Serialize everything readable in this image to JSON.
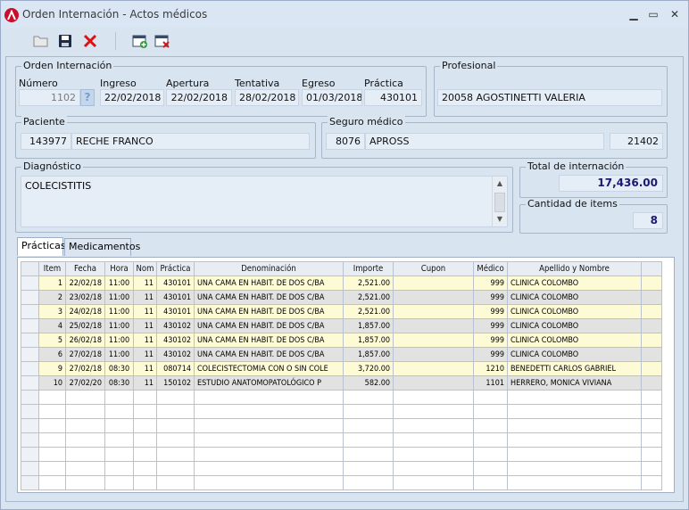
{
  "window": {
    "title": "Orden Internación - Actos médicos",
    "minimize": "▁",
    "maximize": "▭",
    "close": "✕"
  },
  "toolbar": {
    "items": [
      {
        "name": "open-folder-icon",
        "label": "Abrir"
      },
      {
        "name": "save-icon",
        "label": "Guardar"
      },
      {
        "name": "delete-icon",
        "label": "Eliminar"
      },
      {
        "name": "calendar-add-icon",
        "label": "Agregar"
      },
      {
        "name": "calendar-remove-icon",
        "label": "Quitar"
      }
    ]
  },
  "orden": {
    "group_label": "Orden Internación",
    "numero_label": "Número",
    "numero": "1102",
    "help": "?",
    "ingreso_label": "Ingreso",
    "ingreso": "22/02/2018",
    "apertura_label": "Apertura",
    "apertura": "22/02/2018",
    "tentativa_label": "Tentativa",
    "tentativa": "28/02/2018",
    "egreso_label": "Egreso",
    "egreso": "01/03/2018",
    "practica_label": "Práctica",
    "practica": "430101"
  },
  "profesional": {
    "group_label": "Profesional",
    "value": "20058  AGOSTINETTI VALERIA"
  },
  "paciente": {
    "group_label": "Paciente",
    "codigo": "143977",
    "nombre": "RECHE FRANCO"
  },
  "seguro": {
    "group_label": "Seguro médico",
    "codigo": "8076",
    "nombre": "APROSS",
    "numero": "21402"
  },
  "diagnostico": {
    "group_label": "Diagnóstico",
    "value": "COLECISTITIS"
  },
  "total": {
    "group_label": "Total de internación",
    "value": "17,436.00"
  },
  "cantidad": {
    "group_label": "Cantidad de items",
    "value": "8"
  },
  "tabs": [
    {
      "label": "Prácticas",
      "active": true
    },
    {
      "label": "Medicamentos",
      "active": false
    }
  ],
  "grid": {
    "columns": [
      "Item",
      "Fecha",
      "Hora",
      "Nom",
      "Práctica",
      "Denominación",
      "Importe",
      "Cupon",
      "Médico",
      "Apellido y Nombre"
    ],
    "rows": [
      {
        "style": "yel",
        "cells": [
          "1",
          "22/02/18",
          "11:00",
          "11",
          "430101",
          "UNA CAMA EN HABIT. DE DOS C/BA",
          "2,521.00",
          "",
          "999",
          "CLINICA COLOMBO"
        ]
      },
      {
        "style": "gry",
        "cells": [
          "2",
          "23/02/18",
          "11:00",
          "11",
          "430101",
          "UNA CAMA EN HABIT. DE DOS C/BA",
          "2,521.00",
          "",
          "999",
          "CLINICA COLOMBO"
        ]
      },
      {
        "style": "yel",
        "cells": [
          "3",
          "24/02/18",
          "11:00",
          "11",
          "430101",
          "UNA CAMA EN HABIT. DE DOS C/BA",
          "2,521.00",
          "",
          "999",
          "CLINICA COLOMBO"
        ]
      },
      {
        "style": "gry",
        "cells": [
          "4",
          "25/02/18",
          "11:00",
          "11",
          "430102",
          "UNA CAMA EN HABIT. DE DOS C/BA",
          "1,857.00",
          "",
          "999",
          "CLINICA COLOMBO"
        ]
      },
      {
        "style": "yel",
        "cells": [
          "5",
          "26/02/18",
          "11:00",
          "11",
          "430102",
          "UNA CAMA EN HABIT. DE DOS C/BA",
          "1,857.00",
          "",
          "999",
          "CLINICA COLOMBO"
        ]
      },
      {
        "style": "gry",
        "cells": [
          "6",
          "27/02/18",
          "11:00",
          "11",
          "430102",
          "UNA CAMA EN HABIT. DE DOS C/BA",
          "1,857.00",
          "",
          "999",
          "CLINICA COLOMBO"
        ]
      },
      {
        "style": "yel",
        "cells": [
          "9",
          "27/02/18",
          "08:30",
          "11",
          "080714",
          "COLECISTECTOMIA CON O SIN COLE",
          "3,720.00",
          "",
          "1210",
          "BENEDETTI CARLOS GABRIEL"
        ]
      },
      {
        "style": "gry",
        "cells": [
          "10",
          "27/02/20",
          "08:30",
          "11",
          "150102",
          "ESTUDIO ANATOMOPATOLÓGICO P",
          "582.00",
          "",
          "1101",
          "HERRERO, MONICA VIVIANA"
        ]
      }
    ],
    "empty_rows": 7
  },
  "colors": {
    "accent": "#c8102e",
    "row_yellow": "#fdfbd6",
    "row_gray": "#e2e2e2",
    "total_text": "#1a1a6e"
  }
}
